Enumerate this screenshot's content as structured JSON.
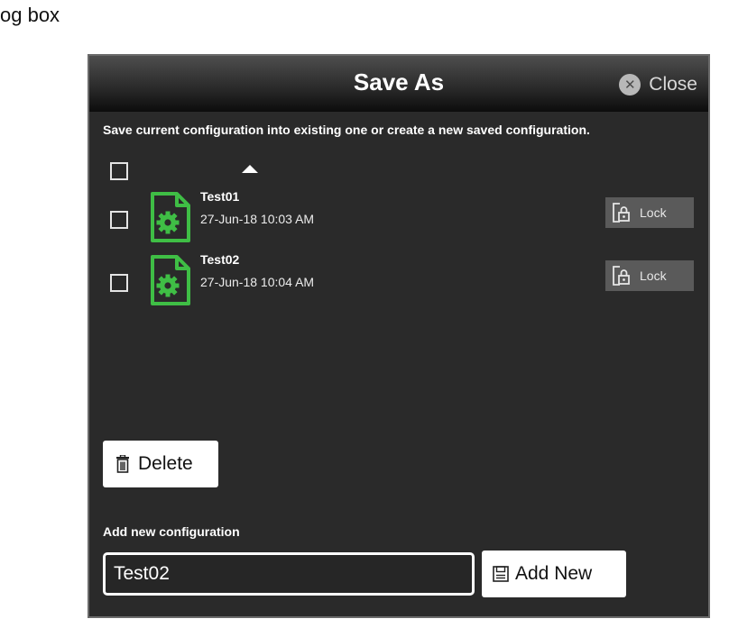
{
  "page": {
    "caption": "og box"
  },
  "dialog": {
    "title": "Save As",
    "close_label": "Close",
    "close_glyph": "✕",
    "description": "Save current configuration into existing one or create a new saved configuration.",
    "items": [
      {
        "name": "Test01",
        "date": "27-Jun-18 10:03 AM",
        "lock_label": "Lock",
        "checked": false
      },
      {
        "name": "Test02",
        "date": "27-Jun-18 10:04 AM",
        "lock_label": "Lock",
        "checked": false
      }
    ],
    "delete_label": "Delete",
    "add_section_label": "Add new configuration",
    "new_name_value": "Test02",
    "add_new_label": "Add New",
    "colors": {
      "title_bar": "#2c2c2c",
      "background": "#2a2a2a",
      "file_icon": "#3fbe45",
      "lock_button": "#5a5a5a"
    },
    "icons": [
      "close-icon",
      "sort-up-icon",
      "config-file-icon",
      "lock-icon",
      "trash-icon",
      "save-icon"
    ]
  }
}
